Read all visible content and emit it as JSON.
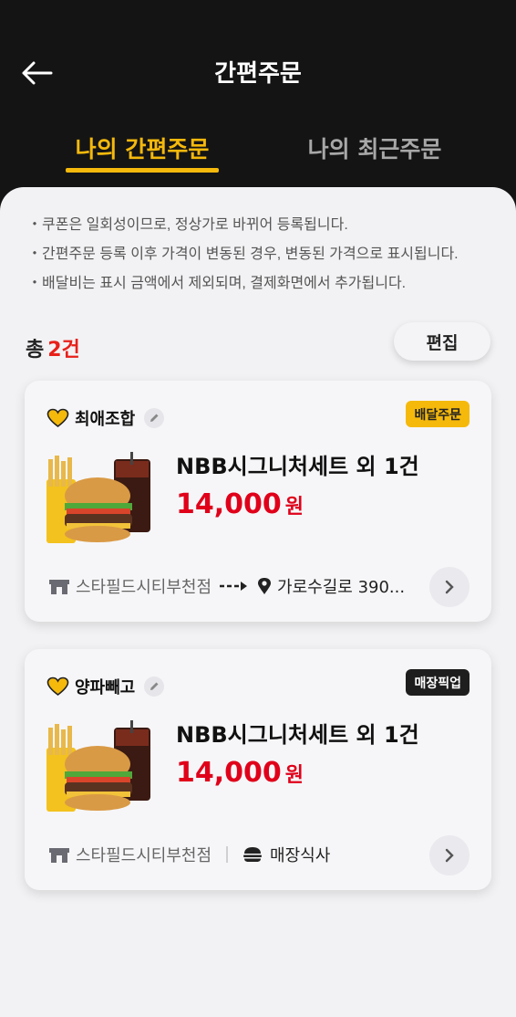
{
  "header": {
    "title": "간편주문"
  },
  "tabs": [
    {
      "label": "나의 간편주문",
      "active": true
    },
    {
      "label": "나의 최근주문",
      "active": false
    }
  ],
  "notes": [
    "・쿠폰은 일회성이므로, 정상가로 바뀌어 등록됩니다.",
    "・간편주문 등록 이후 가격이 변동된 경우, 변동된 가격으로 표시됩니다.",
    "・배달비는 표시 금액에서 제외되며, 결제화면에서 추가됩니다."
  ],
  "count": {
    "prefix": "총",
    "value": "2건"
  },
  "edit_label": "편집",
  "cards": [
    {
      "name": "최애조합",
      "badge": "배달주문",
      "product": "NBB시그니처세트 외 1건",
      "price": "14,000",
      "currency": "원",
      "store": "스타필드시티부천점",
      "address": "가로수길로 390..."
    },
    {
      "name": "양파빼고",
      "badge": "매장픽업",
      "product": "NBB시그니처세트 외 1건",
      "price": "14,000",
      "currency": "원",
      "store": "스타필드시티부천점",
      "dine_option": "매장식사"
    }
  ],
  "colors": {
    "accent": "#f5b90c",
    "price_red": "#e0001a",
    "header_bg": "#141414"
  },
  "icons": [
    "back-arrow-icon",
    "heart-icon",
    "pencil-icon",
    "store-icon",
    "location-pin-icon",
    "dine-in-icon",
    "chevron-right-icon"
  ]
}
